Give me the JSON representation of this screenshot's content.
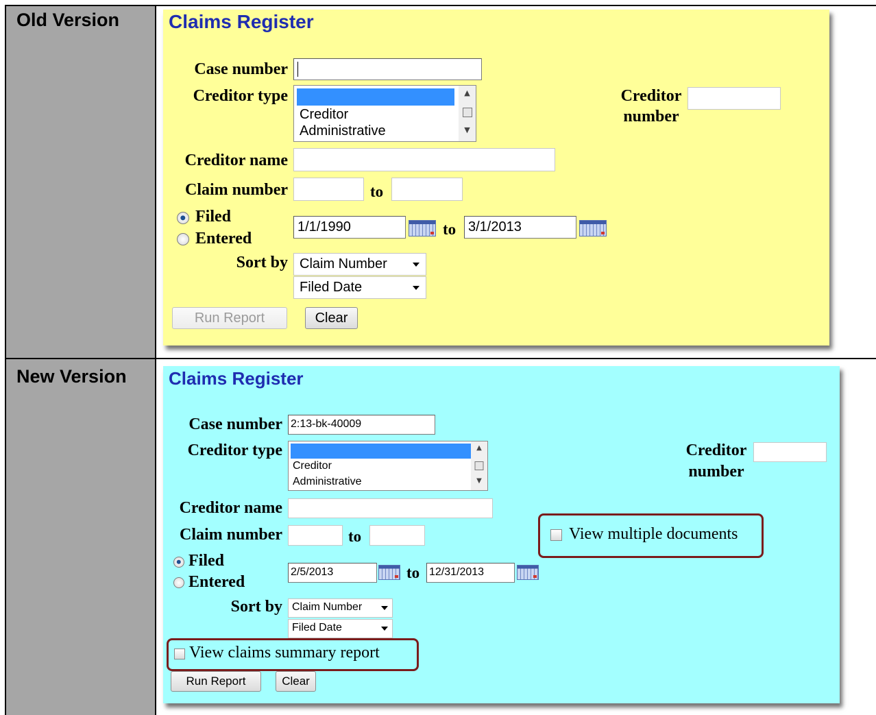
{
  "rows": {
    "old_label": "Old Version",
    "new_label": "New Version"
  },
  "colors": {
    "label_cell_bg": "#a6a6a6",
    "old_panel_bg": "#ffff99",
    "new_panel_bg": "#a3ffff",
    "title_color": "#1f2db0",
    "highlight_border": "#7a1c1c"
  },
  "old": {
    "title": "Claims Register",
    "case_number_label": "Case number",
    "case_number_value": "",
    "creditor_type_label": "Creditor type",
    "creditor_type_options": [
      "",
      "Creditor",
      "Administrative"
    ],
    "creditor_number_label_1": "Creditor",
    "creditor_number_label_2": "number",
    "creditor_number_value": "",
    "creditor_name_label": "Creditor name",
    "creditor_name_value": "",
    "claim_number_label": "Claim number",
    "claim_number_from": "",
    "to_label": "to",
    "claim_number_to": "",
    "filed_label": "Filed",
    "entered_label": "Entered",
    "date_from": "1/1/1990",
    "date_to_label": "to",
    "date_to": "3/1/2013",
    "sort_by_label": "Sort by",
    "sort_primary": "Claim Number",
    "sort_secondary": "Filed Date",
    "run_report": "Run Report",
    "clear": "Clear"
  },
  "new": {
    "title": "Claims Register",
    "case_number_label": "Case number",
    "case_number_value": "2:13-bk-40009",
    "creditor_type_label": "Creditor type",
    "creditor_type_options": [
      "",
      "Creditor",
      "Administrative"
    ],
    "creditor_number_label_1": "Creditor",
    "creditor_number_label_2": "number",
    "creditor_number_value": "",
    "creditor_name_label": "Creditor name",
    "creditor_name_value": "",
    "claim_number_label": "Claim number",
    "claim_number_from": "",
    "to_label": "to",
    "claim_number_to": "",
    "view_multiple_documents": "View multiple documents",
    "filed_label": "Filed",
    "entered_label": "Entered",
    "date_from": "2/5/2013",
    "date_to_label": "to",
    "date_to": "12/31/2013",
    "sort_by_label": "Sort by",
    "sort_primary": "Claim Number",
    "sort_secondary": "Filed Date",
    "view_claims_summary": "View claims summary report",
    "run_report": "Run Report",
    "clear": "Clear"
  }
}
